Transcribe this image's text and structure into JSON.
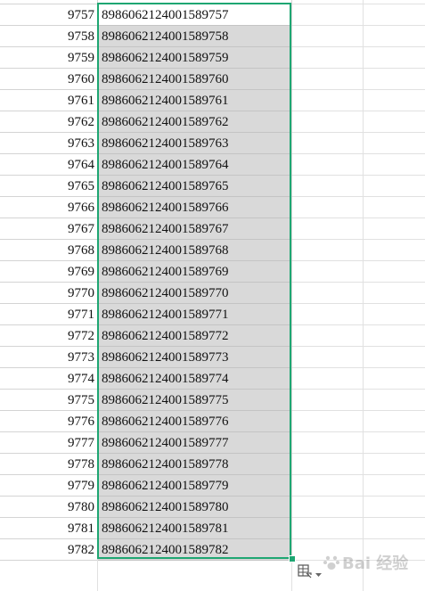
{
  "rows": [
    {
      "number": "9757",
      "value": "8986062124001589757"
    },
    {
      "number": "9758",
      "value": "8986062124001589758"
    },
    {
      "number": "9759",
      "value": "8986062124001589759"
    },
    {
      "number": "9760",
      "value": "8986062124001589760"
    },
    {
      "number": "9761",
      "value": "8986062124001589761"
    },
    {
      "number": "9762",
      "value": "8986062124001589762"
    },
    {
      "number": "9763",
      "value": "8986062124001589763"
    },
    {
      "number": "9764",
      "value": "8986062124001589764"
    },
    {
      "number": "9765",
      "value": "8986062124001589765"
    },
    {
      "number": "9766",
      "value": "8986062124001589766"
    },
    {
      "number": "9767",
      "value": "8986062124001589767"
    },
    {
      "number": "9768",
      "value": "8986062124001589768"
    },
    {
      "number": "9769",
      "value": "8986062124001589769"
    },
    {
      "number": "9770",
      "value": "8986062124001589770"
    },
    {
      "number": "9771",
      "value": "8986062124001589771"
    },
    {
      "number": "9772",
      "value": "8986062124001589772"
    },
    {
      "number": "9773",
      "value": "8986062124001589773"
    },
    {
      "number": "9774",
      "value": "8986062124001589774"
    },
    {
      "number": "9775",
      "value": "8986062124001589775"
    },
    {
      "number": "9776",
      "value": "8986062124001589776"
    },
    {
      "number": "9777",
      "value": "8986062124001589777"
    },
    {
      "number": "9778",
      "value": "8986062124001589778"
    },
    {
      "number": "9779",
      "value": "8986062124001589779"
    },
    {
      "number": "9780",
      "value": "8986062124001589780"
    },
    {
      "number": "9781",
      "value": "8986062124001589781"
    },
    {
      "number": "9782",
      "value": "8986062124001589782"
    }
  ],
  "colors": {
    "selection_border": "#1ea672",
    "selected_fill": "#d9d9d9",
    "gridline": "#d4d4d4"
  },
  "icons": {
    "quick_fill": "auto-fill-options-icon",
    "dropdown": "chevron-down-icon",
    "watermark": "baidu-jingyan-watermark"
  },
  "watermark": {
    "text": "Bai 经验"
  }
}
